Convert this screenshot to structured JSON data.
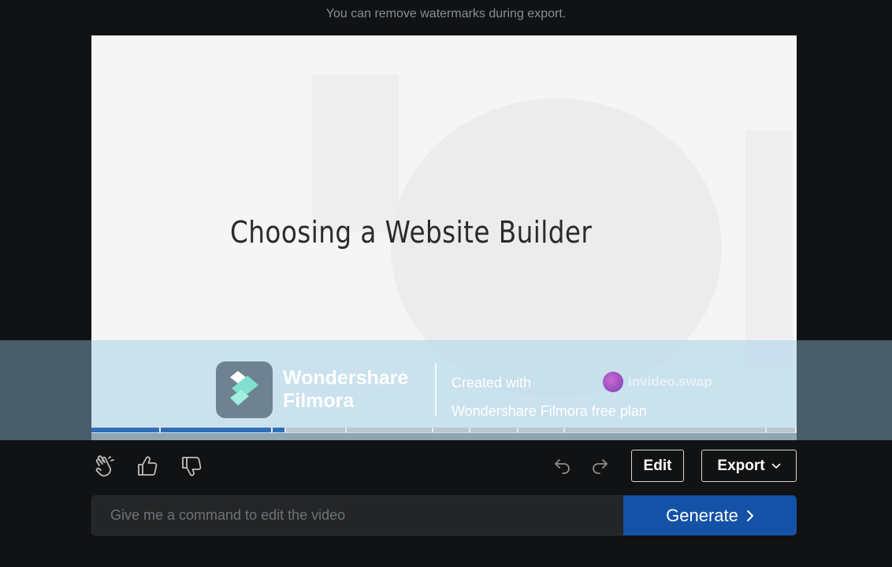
{
  "notice": "You can remove watermarks during export.",
  "video": {
    "title": "Choosing a Website Builder",
    "timeline": {
      "segments": [
        {
          "start": 0.0,
          "end": 0.098,
          "active": true
        },
        {
          "start": 0.098,
          "end": 0.257,
          "active": true
        },
        {
          "start": 0.257,
          "end": 0.276,
          "active": true
        },
        {
          "start": 0.276,
          "end": 0.362,
          "active": false
        },
        {
          "start": 0.362,
          "end": 0.485,
          "active": false
        },
        {
          "start": 0.485,
          "end": 0.537,
          "active": false
        },
        {
          "start": 0.537,
          "end": 0.606,
          "active": false
        },
        {
          "start": 0.606,
          "end": 0.672,
          "active": false
        },
        {
          "start": 0.672,
          "end": 0.957,
          "active": false
        },
        {
          "start": 0.957,
          "end": 1.0,
          "active": false
        }
      ]
    }
  },
  "watermark": {
    "brand_line1": "Wondershare",
    "brand_line2": "Filmora",
    "created_line1": "Created with",
    "created_line2": "Wondershare Filmora free plan",
    "swap_text": "invideo.swap"
  },
  "toolbar": {
    "edit_label": "Edit",
    "export_label": "Export"
  },
  "command": {
    "placeholder": "Give me a command to edit the video",
    "generate_label": "Generate"
  },
  "colors": {
    "background": "#111213",
    "accent": "#1452a8",
    "timeline_active": "#2f6fb7"
  }
}
